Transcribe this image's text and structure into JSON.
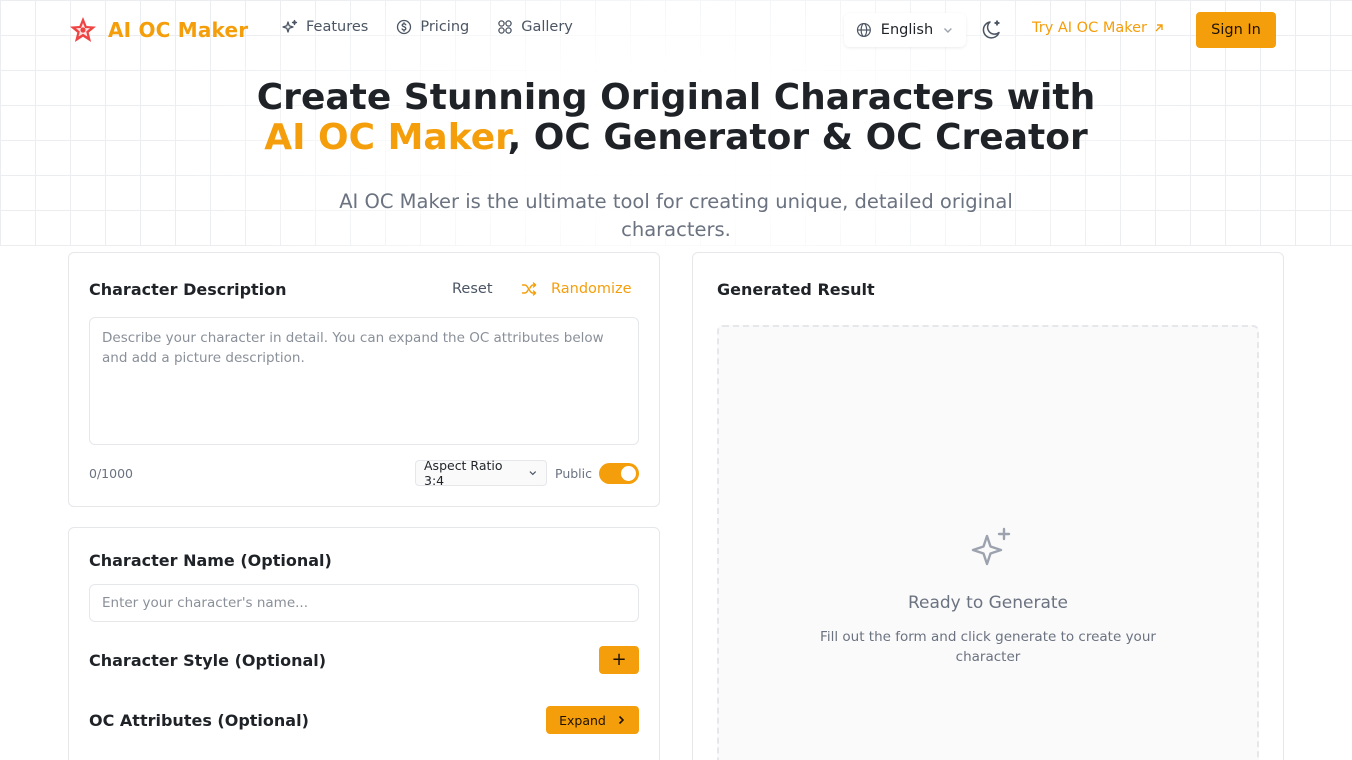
{
  "brand": {
    "name": "AI OC Maker",
    "accent_color": "#f59e0b"
  },
  "nav": {
    "items": [
      {
        "label": "Features",
        "icon": "sparkles-icon"
      },
      {
        "label": "Pricing",
        "icon": "dollar-coin-icon"
      },
      {
        "label": "Gallery",
        "icon": "grid-icon"
      }
    ]
  },
  "header": {
    "language": "English",
    "try_link": "Try AI OC Maker",
    "sign_in": "Sign In"
  },
  "hero": {
    "title_line1": "Create Stunning Original Characters with",
    "title_accent": "AI OC Maker",
    "title_rest": ", OC Generator & OC Creator",
    "subtitle": "AI OC Maker is the ultimate tool for creating unique, detailed original characters."
  },
  "description_card": {
    "title": "Character Description",
    "reset": "Reset",
    "randomize": "Randomize",
    "placeholder": "Describe your character in detail. You can expand the OC attributes below and add a picture description.",
    "value": "",
    "counter": "0/1000",
    "aspect_ratio": "Aspect Ratio 3:4",
    "public_label": "Public",
    "public_on": true
  },
  "options_card": {
    "name_title": "Character Name (Optional)",
    "name_placeholder": "Enter your character's name...",
    "style_title": "Character Style (Optional)",
    "style_button": "+",
    "attributes_title": "OC Attributes (Optional)",
    "expand_button": "Expand"
  },
  "result_card": {
    "title": "Generated Result",
    "ready_title": "Ready to Generate",
    "ready_subtitle": "Fill out the form and click generate to create your character"
  }
}
